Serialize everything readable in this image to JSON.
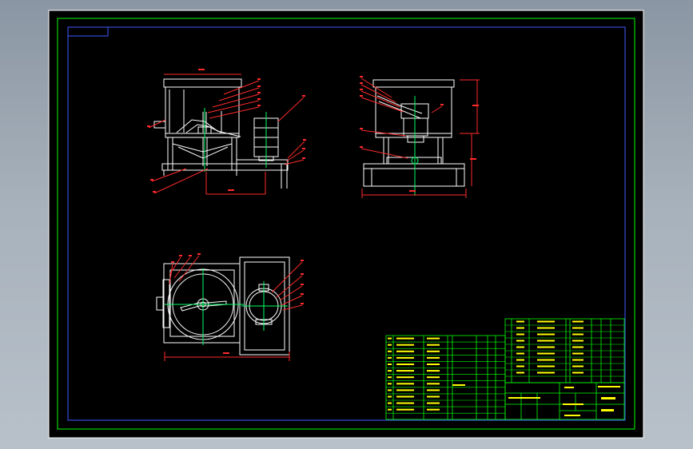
{
  "colors": {
    "background": "#000000",
    "sheet_border": "#ffffff",
    "frame": "#3f5cff",
    "title_block": "#00ff00",
    "geometry": "#ffffff",
    "leader": "#ff2a2a",
    "center": "#00ff66",
    "text_yellow": "#ffff00",
    "text_cyan": "#00ffff",
    "text_magenta": "#ff00ff"
  },
  "icons": [
    "drawing-sheet",
    "front-view",
    "side-view",
    "top-view",
    "title-block"
  ],
  "views": {
    "front": {
      "name": "front-view",
      "balloon_count": 12
    },
    "side": {
      "name": "side-view",
      "balloon_count": 7
    },
    "top": {
      "name": "top-view",
      "balloon_count": 8
    }
  }
}
